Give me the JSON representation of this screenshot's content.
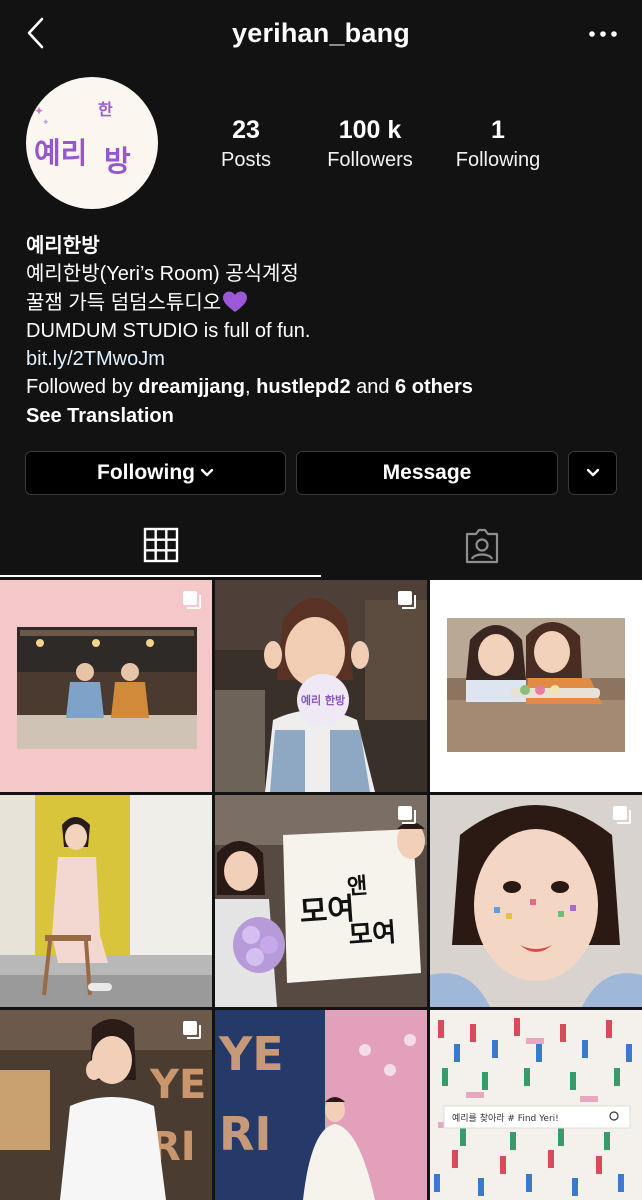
{
  "header": {
    "username": "yerihan_bang",
    "back_icon": "chevron-left-icon",
    "more_icon": "more-horizontal-icon"
  },
  "profile": {
    "avatar_logo_text": "예리한방",
    "stats": [
      {
        "value": "23",
        "label": "Posts"
      },
      {
        "value": "100 k",
        "label": "Followers"
      },
      {
        "value": "1",
        "label": "Following"
      }
    ]
  },
  "bio": {
    "name": "예리한방",
    "line1": "예리한방(Yeri’s Room) 공식계정",
    "line2": "꿀잼 가득 덤덤스튜디오",
    "line2_emoji": "purple-heart-icon",
    "line3": "DUMDUM STUDIO is full of fun.",
    "link": "bit.ly/2TMwoJm",
    "followed_by_prefix": "Followed by ",
    "followed_user1": "dreamjjang",
    "followed_sep": ", ",
    "followed_user2": "hustlepd2",
    "followed_and": " and ",
    "followed_others": "6 others",
    "see_translation": "See Translation"
  },
  "actions": {
    "following_label": "Following",
    "message_label": "Message",
    "dropdown_icon": "chevron-down-icon"
  },
  "tabs": [
    {
      "icon": "grid-icon",
      "active": true
    },
    {
      "icon": "tagged-person-icon",
      "active": false
    }
  ],
  "posts": {
    "post1_caption": "",
    "post2_sign": "예리 한방",
    "post7_word1": "YE",
    "post7_word2": "RI",
    "post8_word1": "YE",
    "post8_word2": "RI",
    "post9_banner": "예리를 찾아라 # Find Yeri!",
    "multi_icon": "multiple-photos-icon"
  },
  "colors": {
    "background": "#121212",
    "button_bg": "#000000",
    "link": "#e0f1ff",
    "heart": "#9b59d8",
    "tile1_bg": "#f4c7c9"
  }
}
